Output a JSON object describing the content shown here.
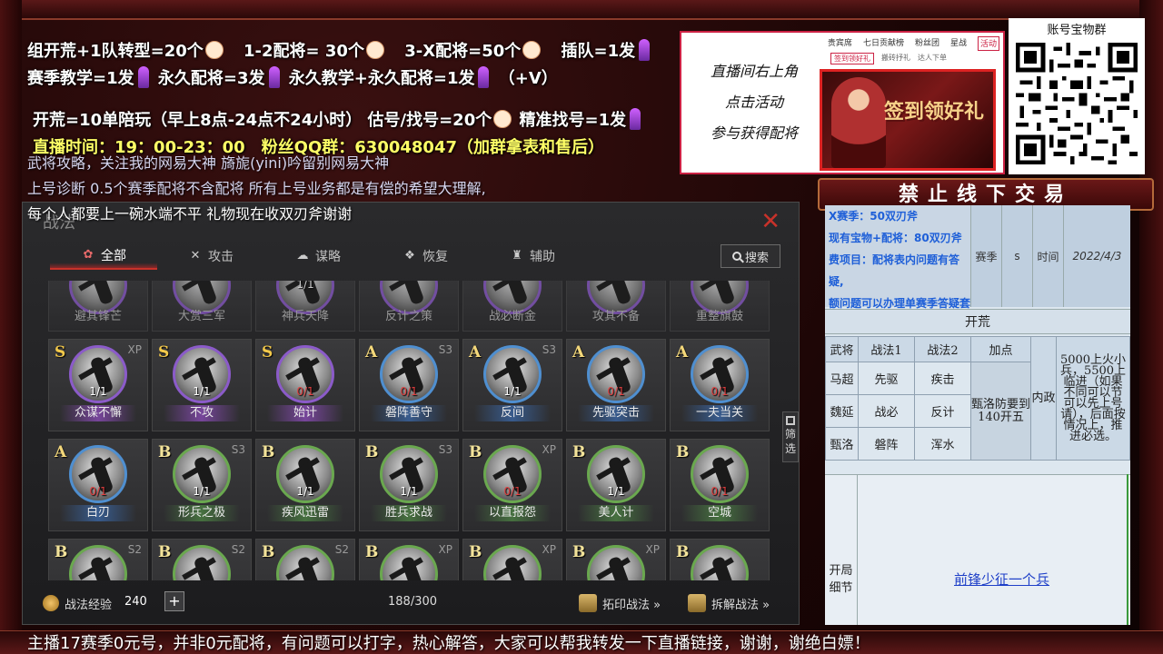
{
  "overlay": {
    "line1": [
      "组开荒+1队转型=20个",
      "1-2配将= 30个",
      "3-X配将=50个",
      "插队=1发"
    ],
    "line2": [
      "赛季教学=1发",
      "永久配将=3发",
      "永久教学+永久配将=1发",
      "（+V）"
    ],
    "line3": [
      "开荒=10单陪玩（早上8点-24点不24小时）",
      "估号/找号=20个",
      "精准找号=1发"
    ],
    "line4": "直播时间：19：00-23：00　粉丝QQ群：630048047（加群拿表和售后）",
    "line5": "武将攻略，关注我的网易大神 旖旎(yini)吟留别网易大神",
    "line6": "上号诊断 0.5个赛季配将不含配将 所有上号业务都是有偿的希望大理解,",
    "line7": "每个人都要上一碗水端不平 礼物现在收双刃斧谢谢",
    "bottom": "主播17赛季0元号，并非0元配将，有问题可以打字，热心解答，大家可以帮我转发一下直播链接，谢谢，谢绝白嫖！"
  },
  "banner": {
    "note": [
      "直播间右上角",
      "点击活动",
      "参与获得配将"
    ],
    "tabs": [
      "贵宾席",
      "七日贡献榜",
      "粉丝团",
      "星战",
      "活动"
    ],
    "subtabs": [
      "签到领好礼",
      "搬砖抒礼",
      "达人下单"
    ],
    "image_text": "签到领好礼"
  },
  "qr": {
    "title": "账号宝物群"
  },
  "notrade": "禁止线下交易",
  "sheet": {
    "head_left": [
      "X赛季：50双刃斧",
      "现有宝物+配将：80双刃斧",
      "费项目：配将表内问题有答疑,",
      "额问题可以办理单赛季答疑套餐"
    ],
    "head_cells": [
      "赛季",
      "s",
      "时间",
      "2022/4/3"
    ],
    "section": "开荒",
    "columns": [
      "武将",
      "战法1",
      "战法2",
      "加点"
    ],
    "rows": [
      [
        "马超",
        "先驱",
        "疾击"
      ],
      [
        "魏延",
        "战必",
        "反计"
      ],
      [
        "甄洛",
        "磐阵",
        "浑水"
      ]
    ],
    "merged": "甄洛防要到140开五",
    "side": "内政",
    "note": "5000上火小兵，5500上临进（如果不同可以节可以先上号请），后面按情况上，推进必选。",
    "lower_side": "开局细节",
    "link": "前锋少征一个兵"
  },
  "game": {
    "title": "战法",
    "tabs": [
      {
        "label": "全部",
        "icon": "all-icon",
        "active": true
      },
      {
        "label": "攻击",
        "icon": "swords-icon"
      },
      {
        "label": "谋略",
        "icon": "scroll-icon"
      },
      {
        "label": "恢复",
        "icon": "heal-icon"
      },
      {
        "label": "辅助",
        "icon": "support-icon"
      }
    ],
    "search": "搜索",
    "filter": "筛选",
    "row0": [
      {
        "name": "避其锋芒"
      },
      {
        "name": "大赏三军"
      },
      {
        "name": "神兵天降",
        "count": "1/1"
      },
      {
        "name": "反计之策"
      },
      {
        "name": "战必断金"
      },
      {
        "name": "攻其不备"
      },
      {
        "name": "重整旗鼓"
      }
    ],
    "row1": [
      {
        "grade": "S",
        "season": "XP",
        "count": "1/1",
        "name": "众谋不懈",
        "tier": "s"
      },
      {
        "grade": "S",
        "season": "",
        "count": "1/1",
        "name": "不攻",
        "tier": "s"
      },
      {
        "grade": "S",
        "season": "",
        "count": "0/1",
        "name": "始计",
        "tier": "s"
      },
      {
        "grade": "A",
        "season": "S3",
        "count": "0/1",
        "name": "磐阵善守",
        "tier": "a"
      },
      {
        "grade": "A",
        "season": "S3",
        "count": "1/1",
        "name": "反间",
        "tier": "a"
      },
      {
        "grade": "A",
        "season": "",
        "count": "0/1",
        "name": "先驱突击",
        "tier": "a"
      },
      {
        "grade": "A",
        "season": "",
        "count": "0/1",
        "name": "一夫当关",
        "tier": "a"
      }
    ],
    "row2": [
      {
        "grade": "A",
        "season": "",
        "count": "0/1",
        "name": "白刃",
        "tier": "a"
      },
      {
        "grade": "B",
        "season": "S3",
        "count": "1/1",
        "name": "形兵之极",
        "tier": "b"
      },
      {
        "grade": "B",
        "season": "",
        "count": "1/1",
        "name": "疾风迅雷",
        "tier": "b"
      },
      {
        "grade": "B",
        "season": "S3",
        "count": "1/1",
        "name": "胜兵求战",
        "tier": "b"
      },
      {
        "grade": "B",
        "season": "XP",
        "count": "0/1",
        "name": "以直报怨",
        "tier": "b"
      },
      {
        "grade": "B",
        "season": "",
        "count": "1/1",
        "name": "美人计",
        "tier": "b"
      },
      {
        "grade": "B",
        "season": "",
        "count": "0/1",
        "name": "空城",
        "tier": "b"
      }
    ],
    "row3": [
      {
        "grade": "B",
        "season": "S2"
      },
      {
        "grade": "B",
        "season": "S2"
      },
      {
        "grade": "B",
        "season": "S2"
      },
      {
        "grade": "B",
        "season": "XP"
      },
      {
        "grade": "B",
        "season": "XP"
      },
      {
        "grade": "B",
        "season": "XP"
      },
      {
        "grade": "B",
        "season": ""
      }
    ],
    "exp_label": "战法经验",
    "exp_value": "240",
    "capacity": "188/300",
    "imprint": "拓印战法 »",
    "disassemble": "拆解战法 »"
  },
  "colors": {
    "grade_s": "#f3c94b",
    "grade_a": "#f3d77a",
    "grade_b": "#f3e39a",
    "accent": "#c8322a"
  }
}
